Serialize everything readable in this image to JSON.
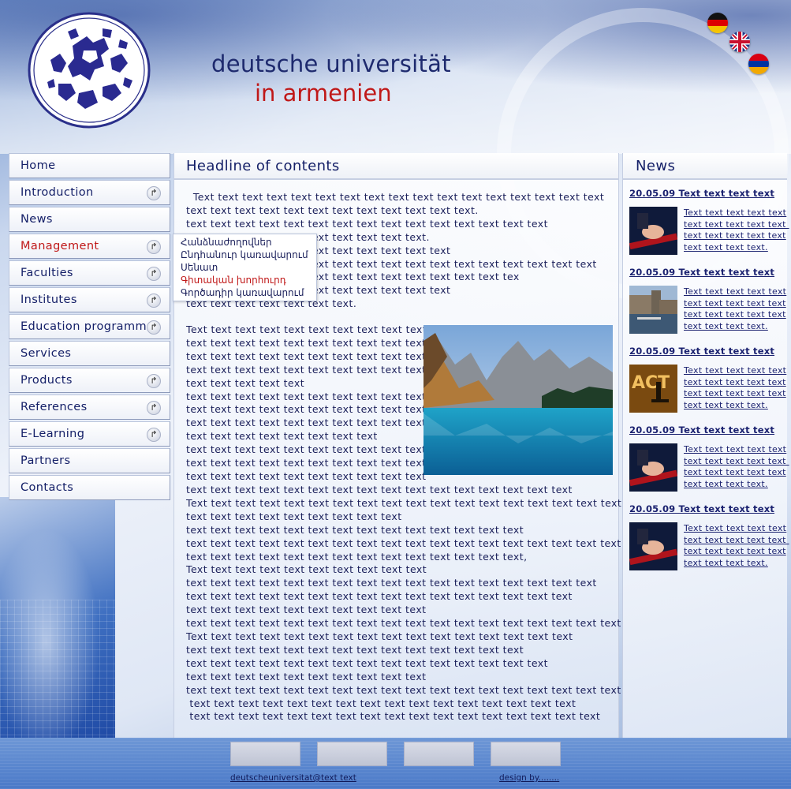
{
  "brand": {
    "line1": "deutsche universität",
    "line2": "in armenien"
  },
  "languages": [
    "de",
    "en",
    "hy"
  ],
  "colors": {
    "accent_red": "#c01818",
    "navy": "#152068",
    "panel_border": "#b9c4dc"
  },
  "nav": {
    "items": [
      {
        "label": "Home",
        "has_submenu": false
      },
      {
        "label": "Introduction",
        "has_submenu": true
      },
      {
        "label": "News",
        "has_submenu": false
      },
      {
        "label": "Management",
        "has_submenu": true,
        "active": true
      },
      {
        "label": "Faculties",
        "has_submenu": true
      },
      {
        "label": "Institutes",
        "has_submenu": true
      },
      {
        "label": "Education programm",
        "has_submenu": true
      },
      {
        "label": "Services",
        "has_submenu": false
      },
      {
        "label": "Products",
        "has_submenu": true
      },
      {
        "label": "References",
        "has_submenu": true
      },
      {
        "label": "E-Learning",
        "has_submenu": true
      },
      {
        "label": "Partners",
        "has_submenu": false
      },
      {
        "label": "Contacts",
        "has_submenu": false
      }
    ],
    "arrow_glyph": "↱"
  },
  "submenu": {
    "items": [
      "Հանձնաժողովներ",
      "Ընդհանուր կառավարում",
      "Սենատ",
      "Գիտական խորհուրդ",
      "Գործադիր կառավարում"
    ],
    "highlighted_index": 3
  },
  "content": {
    "headline": "Headline of contents",
    "paragraph1": "  Text text text text text text text text text text text text text text text text text\ntext text text text text text text text text text text text.\ntext text text text text text text text text text text text text text text\ntext text text text text text text text text text.\ntext text text text text text text text text text text\ntext text text text text text text text text text text text text text text text text\ntext text text text text text text text text text text text text tex\ntext text text text text text text text text text text\ntext text text text text text text.",
    "paragraph2_wrap": "Text text text text text text text text text text\ntext text text text text text text text text text\ntext text text text text text text text text text\ntext text text text text text text text text text\ntext text text text text\ntext text text text text text text text text text\ntext text text text text text text text text text\ntext text text text text text text text text text\ntext text text text text text text text\ntext text text text text text text text text text\ntext text text text text text text text text text\ntext text text text text text text text text text",
    "paragraph2_full": "text text text text text text text text text text text text text text text text\nText text text text text text text text text text text text text text text text text text\ntext text text text text text text text text\ntext text text text text text text text text text text text text text\ntext text text text text text text text text text text text text text text text text text\ntext text text text text text text text text text text text text text,\nText text text text text text text text text text\ntext text text text text text text text text text text text text text text text text\ntext text text text text text text text text text text text text text text text\ntext text text text text text text text text text\ntext text text text text text text text text text text text text text text text text text\nText text text text text text text text text text text text text text text text\ntext text text text text text text text text text text text text text\ntext text text text text text text text text text text text text text text\ntext text text text text text text text text text\ntext text text text text text text text text text text text text text text text text text\n text text text text text text text text text text text text text text text text\n text text text text text text text text text text text text text text text text text"
  },
  "news": {
    "heading": "News",
    "items": [
      {
        "date": "20.05.09 Text text text text",
        "text": "Text text text text text\ntext text text text text \ntext text text text text\ntext text text text.",
        "thumb": "handshake-ribbon"
      },
      {
        "date": "20.05.09 Text text text text",
        "text": "Text text text text text\ntext text text text text\ntext text text text text\ntext text text text.",
        "thumb": "harbor-city"
      },
      {
        "date": "20.05.09 Text text text text",
        "text": "Text text text text text\ntext text text text text\ntext text text text text\ntext text text text.",
        "thumb": "stage-performer"
      },
      {
        "date": "20.05.09 Text text text text",
        "text": "Text text text text text\ntext text text text text \ntext text text text text\ntext text text text.",
        "thumb": "handshake-ribbon"
      },
      {
        "date": "20.05.09 Text text text text",
        "text": "Text text text text text\ntext text text text text \ntext text text text text\ntext text text text.",
        "thumb": "handshake-ribbon"
      }
    ]
  },
  "footer": {
    "email_link": "deutscheuniversitat@text text",
    "design_link": "design by........"
  }
}
